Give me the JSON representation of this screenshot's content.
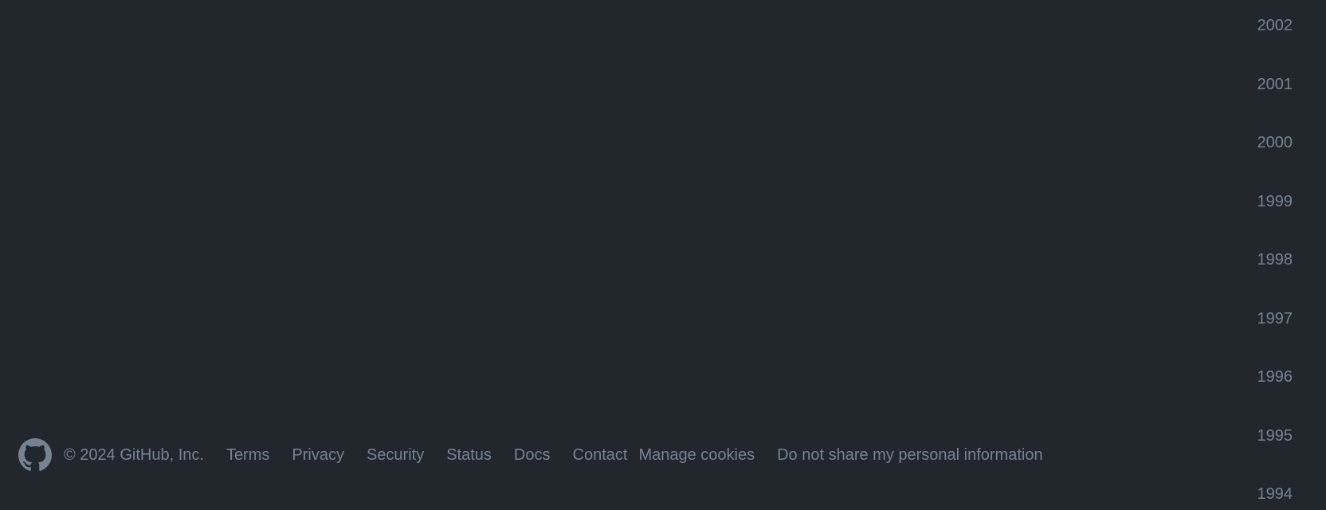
{
  "sidebar": {
    "years": [
      "2002",
      "2001",
      "2000",
      "1999",
      "1998",
      "1997",
      "1996",
      "1995",
      "1994"
    ]
  },
  "footer": {
    "logo_icon": "github-mark-icon",
    "copyright": "© 2024 GitHub, Inc.",
    "links": [
      "Terms",
      "Privacy",
      "Security",
      "Status",
      "Docs",
      "Contact",
      "Manage cookies",
      "Do not share my personal information"
    ]
  },
  "colors": {
    "background": "#22272e",
    "muted_text": "#768390"
  }
}
